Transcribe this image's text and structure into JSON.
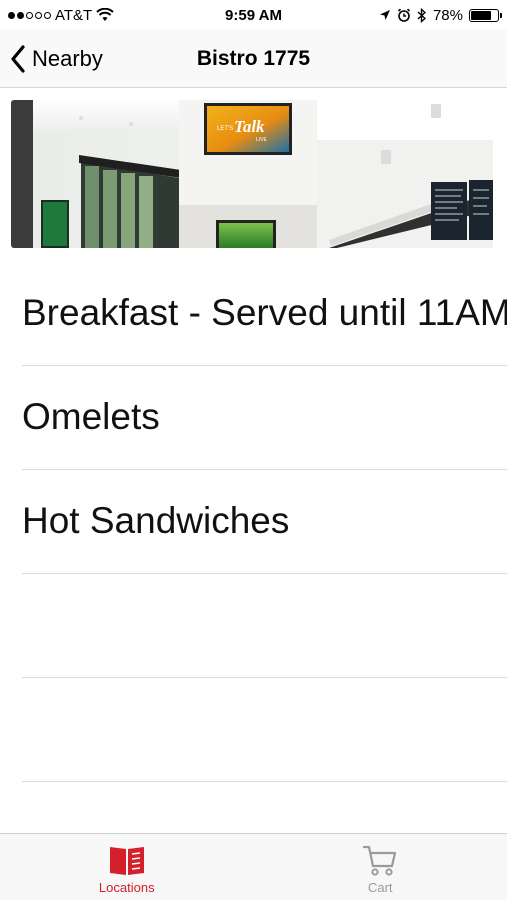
{
  "status_bar": {
    "carrier": "AT&T",
    "time": "9:59 AM",
    "battery": "78%",
    "battery_level": 0.78,
    "signal_bars_filled": 2,
    "signal_bars_total": 5
  },
  "nav": {
    "back_label": "Nearby",
    "title": "Bistro 1775"
  },
  "hero": {
    "tv_text_top": "LET'S",
    "tv_text_main": "Talk",
    "tv_text_bottom": "LIVE"
  },
  "menu": {
    "items": [
      {
        "label": "Breakfast - Served until 11AM"
      },
      {
        "label": "Omelets"
      },
      {
        "label": "Hot Sandwiches"
      },
      {
        "label": ""
      },
      {
        "label": ""
      }
    ]
  },
  "tab_bar": {
    "tabs": [
      {
        "label": "Locations",
        "icon": "locations-icon",
        "active": true
      },
      {
        "label": "Cart",
        "icon": "cart-icon",
        "active": false
      }
    ]
  },
  "colors": {
    "accent": "#d3202a",
    "inactive": "#9a9a9a",
    "separator": "#dcdcdc"
  }
}
